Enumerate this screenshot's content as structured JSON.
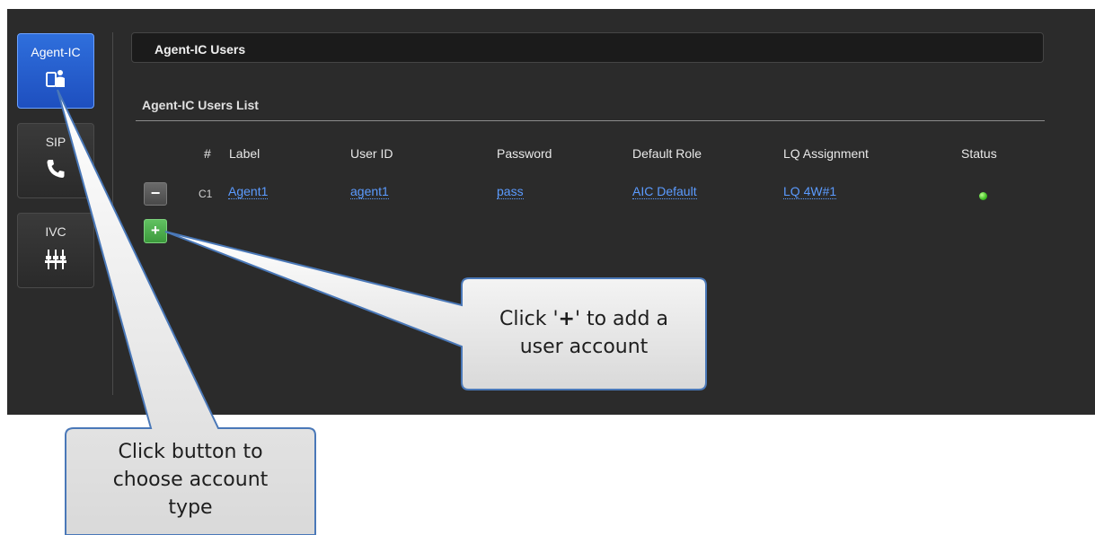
{
  "sidebar": {
    "items": [
      {
        "label": "Agent-IC",
        "icon": "agent-device-icon",
        "active": true
      },
      {
        "label": "SIP",
        "icon": "phone-icon",
        "active": false
      },
      {
        "label": "IVC",
        "icon": "mixer-sliders-icon",
        "active": false
      }
    ]
  },
  "header": {
    "title": "Agent-IC Users"
  },
  "list": {
    "title": "Agent-IC Users List",
    "columns": [
      "#",
      "Label",
      "User ID",
      "Password",
      "Default Role",
      "LQ Assignment",
      "Status"
    ],
    "rows": [
      {
        "num": "C1",
        "label": "Agent1",
        "user_id": "agent1",
        "password": "pass",
        "role": "AIC Default",
        "lq": "LQ 4W#1",
        "status": "online"
      }
    ],
    "remove_button": "−",
    "add_button": "+"
  },
  "callouts": {
    "add": {
      "line1_pre": "Click '",
      "line1_bold": "+",
      "line1_post": "' to add a",
      "line2": "user account"
    },
    "type": {
      "line1": "Click button to",
      "line2": "choose account",
      "line3": "type"
    }
  },
  "colors": {
    "accent": "#2f6fdc",
    "link": "#5b9bff",
    "add_green": "#4caf50",
    "status_green": "#3fbf24"
  }
}
